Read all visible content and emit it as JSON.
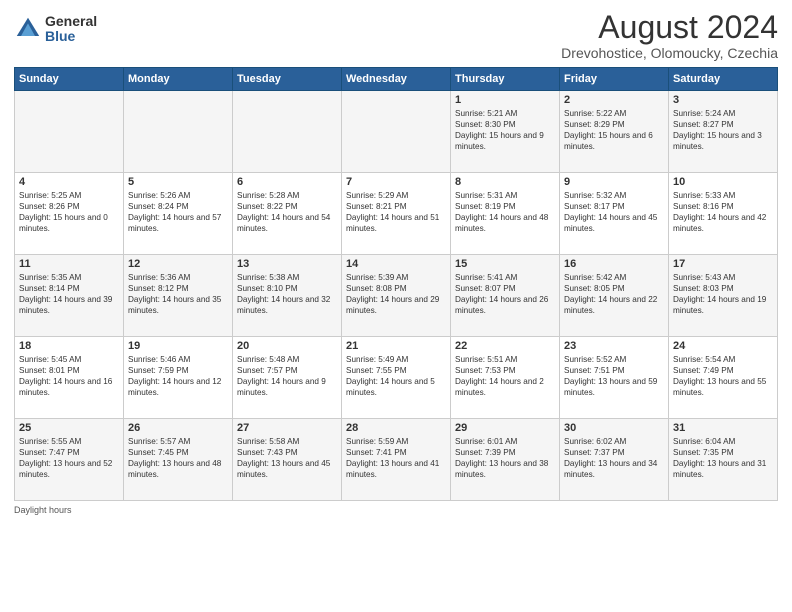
{
  "header": {
    "logo_general": "General",
    "logo_blue": "Blue",
    "main_title": "August 2024",
    "subtitle": "Drevohostice, Olomoucky, Czechia"
  },
  "days_of_week": [
    "Sunday",
    "Monday",
    "Tuesday",
    "Wednesday",
    "Thursday",
    "Friday",
    "Saturday"
  ],
  "weeks": [
    [
      {
        "day": "",
        "info": ""
      },
      {
        "day": "",
        "info": ""
      },
      {
        "day": "",
        "info": ""
      },
      {
        "day": "",
        "info": ""
      },
      {
        "day": "1",
        "info": "Sunrise: 5:21 AM\nSunset: 8:30 PM\nDaylight: 15 hours and 9 minutes."
      },
      {
        "day": "2",
        "info": "Sunrise: 5:22 AM\nSunset: 8:29 PM\nDaylight: 15 hours and 6 minutes."
      },
      {
        "day": "3",
        "info": "Sunrise: 5:24 AM\nSunset: 8:27 PM\nDaylight: 15 hours and 3 minutes."
      }
    ],
    [
      {
        "day": "4",
        "info": "Sunrise: 5:25 AM\nSunset: 8:26 PM\nDaylight: 15 hours and 0 minutes."
      },
      {
        "day": "5",
        "info": "Sunrise: 5:26 AM\nSunset: 8:24 PM\nDaylight: 14 hours and 57 minutes."
      },
      {
        "day": "6",
        "info": "Sunrise: 5:28 AM\nSunset: 8:22 PM\nDaylight: 14 hours and 54 minutes."
      },
      {
        "day": "7",
        "info": "Sunrise: 5:29 AM\nSunset: 8:21 PM\nDaylight: 14 hours and 51 minutes."
      },
      {
        "day": "8",
        "info": "Sunrise: 5:31 AM\nSunset: 8:19 PM\nDaylight: 14 hours and 48 minutes."
      },
      {
        "day": "9",
        "info": "Sunrise: 5:32 AM\nSunset: 8:17 PM\nDaylight: 14 hours and 45 minutes."
      },
      {
        "day": "10",
        "info": "Sunrise: 5:33 AM\nSunset: 8:16 PM\nDaylight: 14 hours and 42 minutes."
      }
    ],
    [
      {
        "day": "11",
        "info": "Sunrise: 5:35 AM\nSunset: 8:14 PM\nDaylight: 14 hours and 39 minutes."
      },
      {
        "day": "12",
        "info": "Sunrise: 5:36 AM\nSunset: 8:12 PM\nDaylight: 14 hours and 35 minutes."
      },
      {
        "day": "13",
        "info": "Sunrise: 5:38 AM\nSunset: 8:10 PM\nDaylight: 14 hours and 32 minutes."
      },
      {
        "day": "14",
        "info": "Sunrise: 5:39 AM\nSunset: 8:08 PM\nDaylight: 14 hours and 29 minutes."
      },
      {
        "day": "15",
        "info": "Sunrise: 5:41 AM\nSunset: 8:07 PM\nDaylight: 14 hours and 26 minutes."
      },
      {
        "day": "16",
        "info": "Sunrise: 5:42 AM\nSunset: 8:05 PM\nDaylight: 14 hours and 22 minutes."
      },
      {
        "day": "17",
        "info": "Sunrise: 5:43 AM\nSunset: 8:03 PM\nDaylight: 14 hours and 19 minutes."
      }
    ],
    [
      {
        "day": "18",
        "info": "Sunrise: 5:45 AM\nSunset: 8:01 PM\nDaylight: 14 hours and 16 minutes."
      },
      {
        "day": "19",
        "info": "Sunrise: 5:46 AM\nSunset: 7:59 PM\nDaylight: 14 hours and 12 minutes."
      },
      {
        "day": "20",
        "info": "Sunrise: 5:48 AM\nSunset: 7:57 PM\nDaylight: 14 hours and 9 minutes."
      },
      {
        "day": "21",
        "info": "Sunrise: 5:49 AM\nSunset: 7:55 PM\nDaylight: 14 hours and 5 minutes."
      },
      {
        "day": "22",
        "info": "Sunrise: 5:51 AM\nSunset: 7:53 PM\nDaylight: 14 hours and 2 minutes."
      },
      {
        "day": "23",
        "info": "Sunrise: 5:52 AM\nSunset: 7:51 PM\nDaylight: 13 hours and 59 minutes."
      },
      {
        "day": "24",
        "info": "Sunrise: 5:54 AM\nSunset: 7:49 PM\nDaylight: 13 hours and 55 minutes."
      }
    ],
    [
      {
        "day": "25",
        "info": "Sunrise: 5:55 AM\nSunset: 7:47 PM\nDaylight: 13 hours and 52 minutes."
      },
      {
        "day": "26",
        "info": "Sunrise: 5:57 AM\nSunset: 7:45 PM\nDaylight: 13 hours and 48 minutes."
      },
      {
        "day": "27",
        "info": "Sunrise: 5:58 AM\nSunset: 7:43 PM\nDaylight: 13 hours and 45 minutes."
      },
      {
        "day": "28",
        "info": "Sunrise: 5:59 AM\nSunset: 7:41 PM\nDaylight: 13 hours and 41 minutes."
      },
      {
        "day": "29",
        "info": "Sunrise: 6:01 AM\nSunset: 7:39 PM\nDaylight: 13 hours and 38 minutes."
      },
      {
        "day": "30",
        "info": "Sunrise: 6:02 AM\nSunset: 7:37 PM\nDaylight: 13 hours and 34 minutes."
      },
      {
        "day": "31",
        "info": "Sunrise: 6:04 AM\nSunset: 7:35 PM\nDaylight: 13 hours and 31 minutes."
      }
    ]
  ],
  "footer": "Daylight hours"
}
